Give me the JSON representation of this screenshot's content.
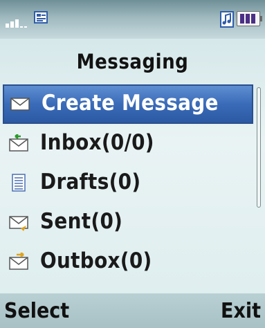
{
  "status_bar": {
    "signal_icon": "signal-strength-icon",
    "message_status_icon": "message-status-icon",
    "music_icon": "music-note-icon",
    "battery_icon": "battery-icon",
    "battery_level": 1.0
  },
  "screen": {
    "title": "Messaging"
  },
  "menu": {
    "items": [
      {
        "label": "Create Message",
        "icon": "envelope-icon",
        "selected": true
      },
      {
        "label": "Inbox(0/0)",
        "icon": "inbox-icon",
        "selected": false
      },
      {
        "label": "Drafts(0)",
        "icon": "drafts-icon",
        "selected": false
      },
      {
        "label": "Sent(0)",
        "icon": "sent-icon",
        "selected": false
      },
      {
        "label": "Outbox(0)",
        "icon": "outbox-icon",
        "selected": false
      }
    ]
  },
  "softkeys": {
    "left": "Select",
    "right": "Exit"
  },
  "colors": {
    "selection": "#3a6bb8",
    "background": "#e2eff0",
    "softkey_bar": "#aec7ca"
  }
}
